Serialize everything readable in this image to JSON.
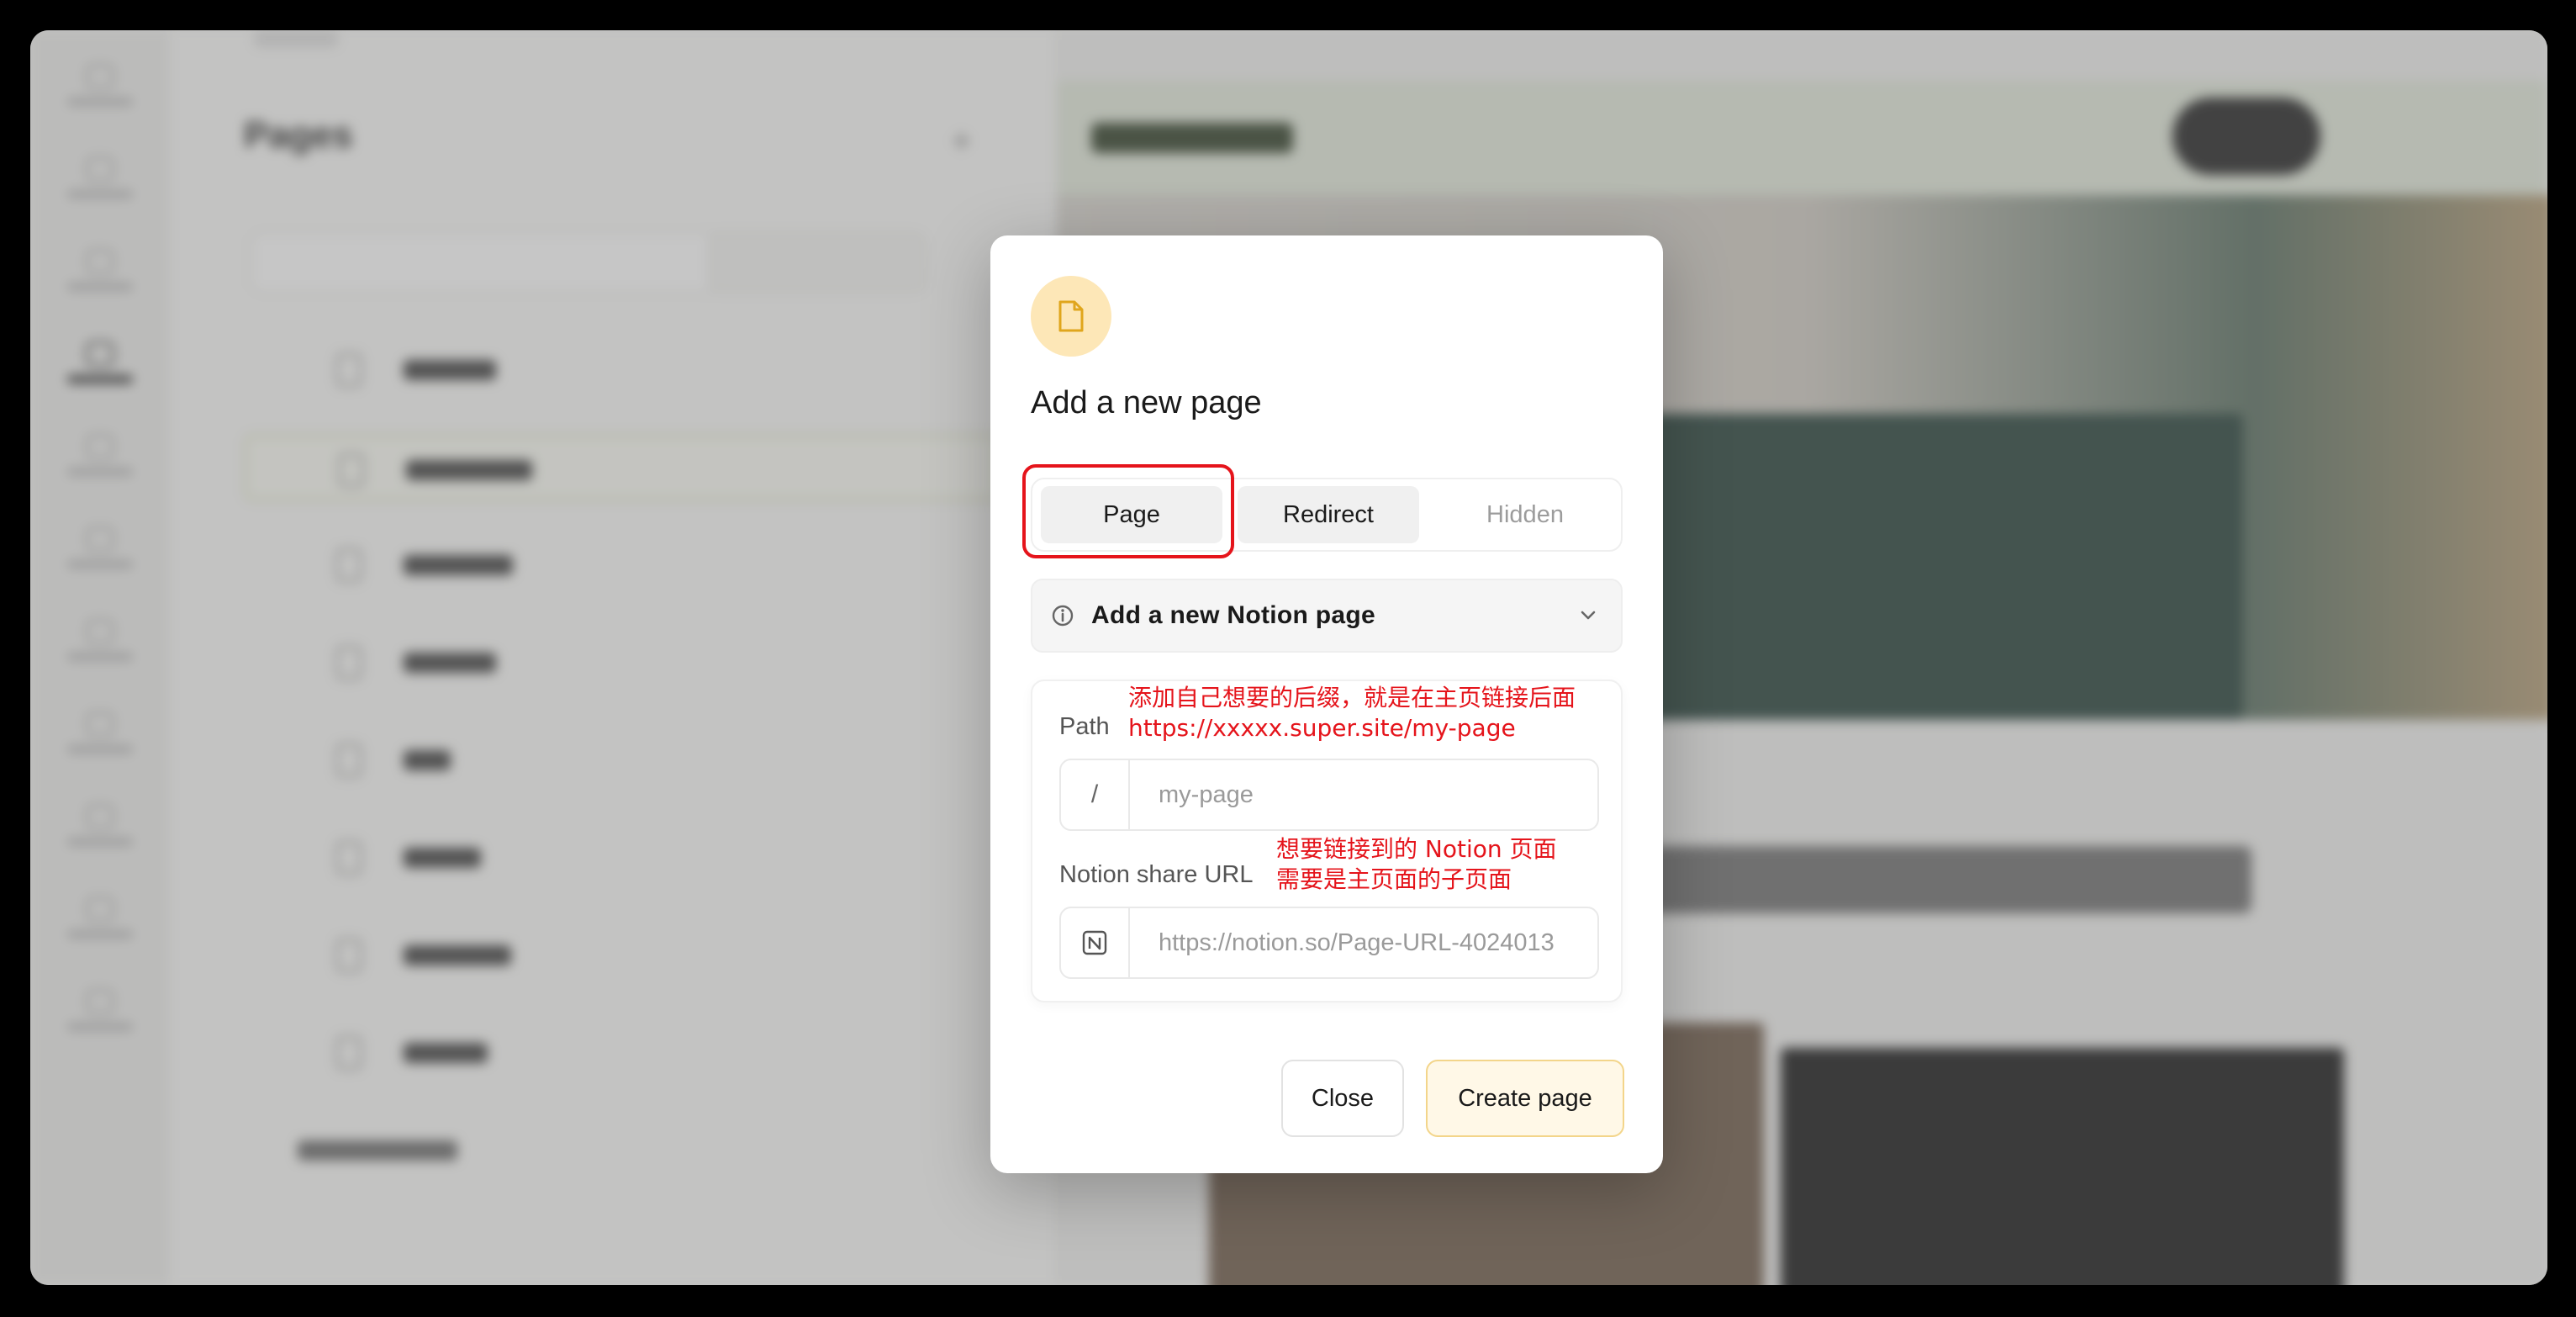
{
  "background": {
    "sidebar_title": "Pages"
  },
  "modal": {
    "title": "Add a new page",
    "tabs": [
      {
        "label": "Page",
        "selected": true
      },
      {
        "label": "Redirect",
        "selected": false
      },
      {
        "label": "Hidden",
        "selected": false
      }
    ],
    "accordion_label": "Add a new Notion page",
    "path": {
      "label": "Path",
      "prefix": "/",
      "placeholder": "my-page",
      "value": ""
    },
    "notion_url": {
      "label": "Notion share URL",
      "placeholder": "https://notion.so/Page-URL-4024013",
      "value": ""
    },
    "close_label": "Close",
    "create_label": "Create page"
  },
  "annotations": {
    "path_line1": "添加自己想要的后缀，就是在主页链接后面",
    "path_line2": "https://xxxxx.super.site/my-page",
    "notion_line1": "想要链接到的 Notion 页面",
    "notion_line2": "需要是主页面的子页面"
  },
  "colors": {
    "annotation_red": "#e5141b",
    "badge_bg": "#fde7b7",
    "create_button_bg": "#fff8e7"
  }
}
